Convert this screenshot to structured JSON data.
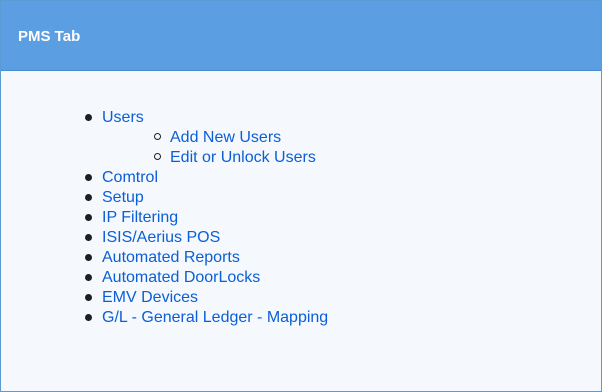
{
  "panel": {
    "title": "PMS Tab"
  },
  "toc": {
    "items": [
      {
        "label": "Users",
        "children": [
          {
            "label": "Add New Users"
          },
          {
            "label": "Edit or Unlock Users"
          }
        ]
      },
      {
        "label": "Comtrol"
      },
      {
        "label": "Setup"
      },
      {
        "label": "IP Filtering"
      },
      {
        "label": "ISIS/Aerius POS"
      },
      {
        "label": "Automated Reports"
      },
      {
        "label": "Automated DoorLocks"
      },
      {
        "label": "EMV Devices"
      },
      {
        "label": "G/L - General Ledger - Mapping"
      }
    ]
  },
  "colors": {
    "header_bg": "#5b9ee1",
    "panel_border": "#5b9bd5",
    "link": "#0b5fd6",
    "body_bg": "#f5f8fd"
  }
}
